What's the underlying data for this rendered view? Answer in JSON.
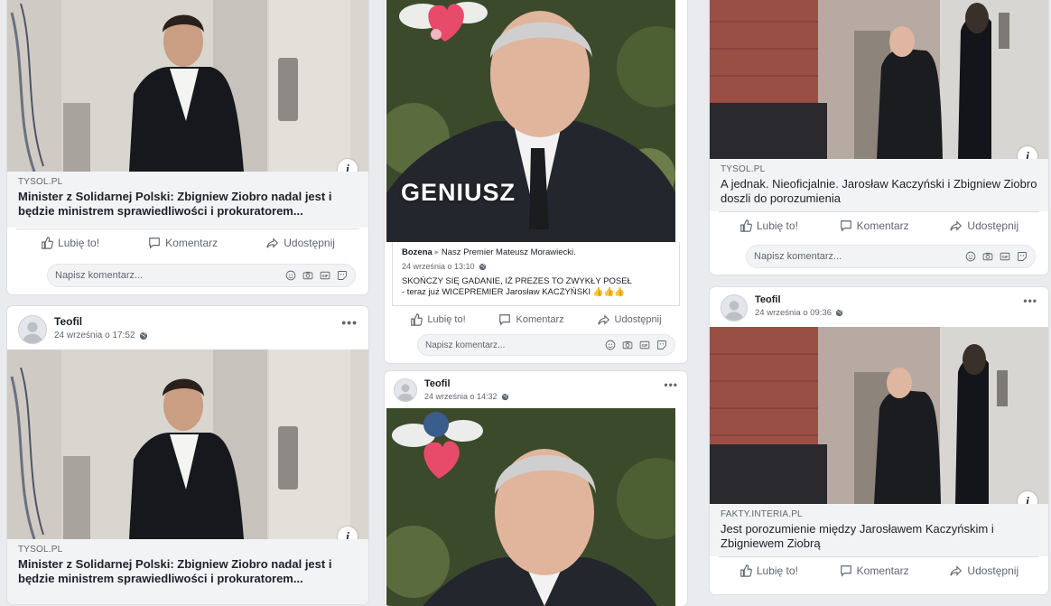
{
  "col1": {
    "top_post": {
      "domain": "TYSOL.PL",
      "title": "Minister z Solidarnej Polski: Zbigniew Ziobro nadal jest i będzie ministrem sprawiedliwości i prokuratorem...",
      "actions": {
        "like": "Lubię to!",
        "comment": "Komentarz",
        "share": "Udostępnij"
      },
      "comment_placeholder": "Napisz komentarz..."
    },
    "second_post": {
      "author": "Teofil",
      "time": "24 września o 17:52",
      "domain": "TYSOL.PL",
      "title": "Minister z Solidarnej Polski: Zbigniew Ziobro nadal jest i będzie ministrem sprawiedliwości i prokuratorem..."
    }
  },
  "col2": {
    "top_post": {
      "image_caption": "GENIUSZ",
      "comment_author": "Bozena",
      "comment_target": "Nasz Premier Mateusz Morawiecki.",
      "comment_time": "24 września o 13:10",
      "comment_line1": "SKOŃCZY SIĘ GADANIE, IŻ PREZES TO ZWYKŁY POSEŁ",
      "comment_line2": "- teraz już WICEPREMIER Jarosław KACZYŃSKI 👍👍👍",
      "actions": {
        "like": "Lubię to!",
        "comment": "Komentarz",
        "share": "Udostępnij"
      },
      "comment_placeholder": "Napisz komentarz..."
    },
    "second_post": {
      "author": "Teofil",
      "time": "24 września o 14:32"
    }
  },
  "col3": {
    "top_post": {
      "domain": "TYSOL.PL",
      "title": "A jednak. Nieoficjalnie. Jarosław Kaczyński i Zbigniew Ziobro doszli do porozumienia",
      "actions": {
        "like": "Lubię to!",
        "comment": "Komentarz",
        "share": "Udostępnij"
      },
      "comment_placeholder": "Napisz komentarz..."
    },
    "second_post": {
      "author": "Teofil",
      "time": "24 września o 09:36",
      "domain": "FAKTY.INTERIA.PL",
      "title": "Jest porozumienie między Jarosławem Kaczyńskim i Zbigniewem Ziobrą",
      "actions": {
        "like": "Lubię to!",
        "comment": "Komentarz",
        "share": "Udostępnij"
      }
    }
  },
  "icons": [
    "like-icon",
    "comment-icon",
    "share-icon",
    "emoji-icon",
    "camera-icon",
    "gif-icon",
    "sticker-icon",
    "globe-icon",
    "more-icon",
    "info-icon",
    "avatar-icon"
  ]
}
